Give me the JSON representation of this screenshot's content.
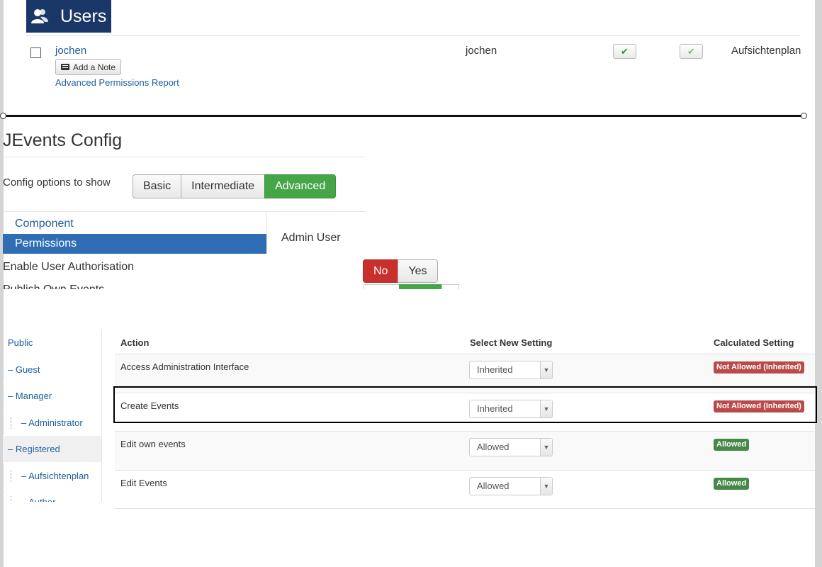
{
  "users_panel": {
    "title": "Users",
    "icon": "users-icon",
    "row": {
      "name": "jochen",
      "add_note_label": "Add a Note",
      "adv_perm_label": "Advanced Permissions Report",
      "username": "jochen",
      "enabled_check": "✔",
      "activated_check": "✔",
      "group": "Aufsichtenplan"
    }
  },
  "config_panel": {
    "title": "JEvents Config",
    "config_options_label": "Config options to show",
    "levels": [
      "Basic",
      "Intermediate",
      "Advanced"
    ],
    "active_level": "Advanced",
    "nav": {
      "component": "Component",
      "permissions": "Permissions"
    },
    "tab_label": "Admin User",
    "auth_label": "Enable User Authorisation",
    "no_label": "No",
    "yes_label": "Yes",
    "clipped_label": "Publish Own Events",
    "colors": {
      "green": "#46a546",
      "red": "#c9302c",
      "blue": "#2f6eb5"
    }
  },
  "permissions_panel": {
    "groups": [
      "Public",
      "– Guest",
      "– Manager",
      "– Administrator",
      "– Registered",
      "– Aufsichtenplan",
      "– Author"
    ],
    "headers": {
      "action": "Action",
      "select_new": "Select New Setting",
      "calculated": "Calculated Setting"
    },
    "rows": [
      {
        "action": "Access Administration Interface",
        "setting": "Inherited",
        "calculated": "Not Allowed (Inherited)",
        "status": "red"
      },
      {
        "action": "Create Events",
        "setting": "Inherited",
        "calculated": "Not Allowed (Inherited)",
        "status": "red"
      },
      {
        "action": "Edit own events",
        "setting": "Allowed",
        "calculated": "Allowed",
        "status": "green"
      },
      {
        "action": "Edit Events",
        "setting": "Allowed",
        "calculated": "Allowed",
        "status": "green"
      }
    ],
    "highlighted_row": "Create Events"
  }
}
